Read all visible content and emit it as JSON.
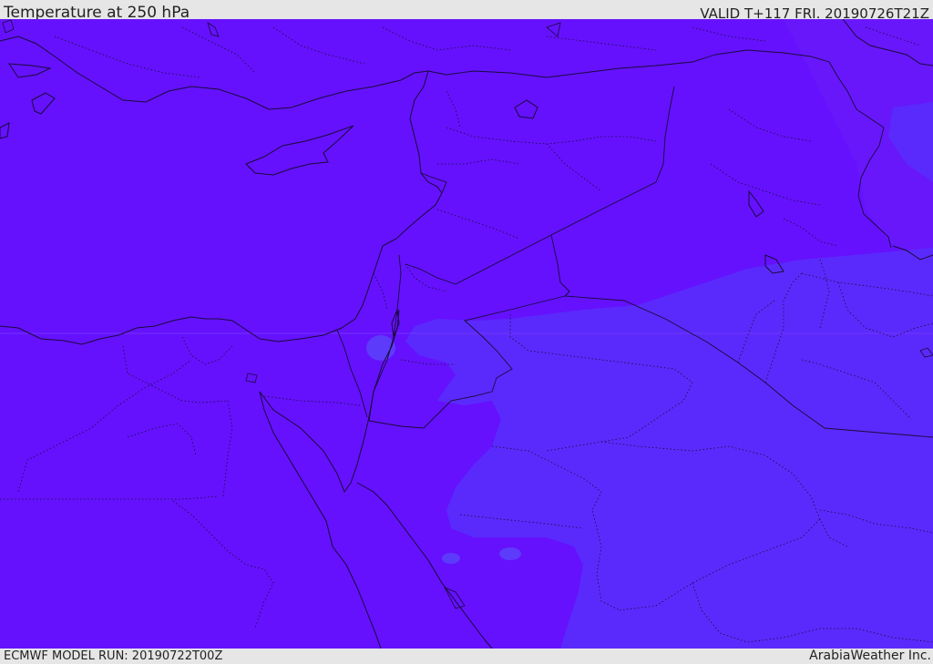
{
  "header": {
    "title": "Temperature at 250 hPa",
    "valid_time": "VALID T+117 FRI. 20190726T21Z"
  },
  "footer": {
    "model_run": "ECMWF MODEL RUN: 20190722T00Z",
    "credit": "ArabiaWeather Inc."
  },
  "map": {
    "colors": {
      "field_base": "#6511fd",
      "field_cooler": "#5a2afc",
      "field_mid": "#6a1dfa",
      "field_patch": "#5c3bfb",
      "coastline": "#1a0a3a",
      "border": "#1a0a3a"
    }
  }
}
